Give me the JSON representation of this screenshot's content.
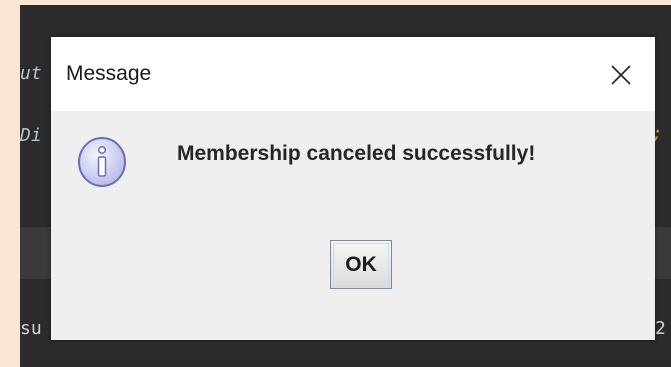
{
  "background_code": {
    "fragment_1": "ut",
    "fragment_2": "Di",
    "fragment_3": ";",
    "fragment_4": "su",
    "fragment_5": "2"
  },
  "dialog": {
    "title": "Message",
    "message": "Membership canceled successfully!",
    "ok_label": "OK",
    "close_glyph": "×"
  },
  "icons": {
    "info": "info-icon",
    "close": "close-icon"
  },
  "colors": {
    "ide_background": "#2b2b2b",
    "dialog_background": "#efefef",
    "info_icon_fill": "#cfd2f2",
    "info_icon_stroke": "#6b6fb8"
  }
}
